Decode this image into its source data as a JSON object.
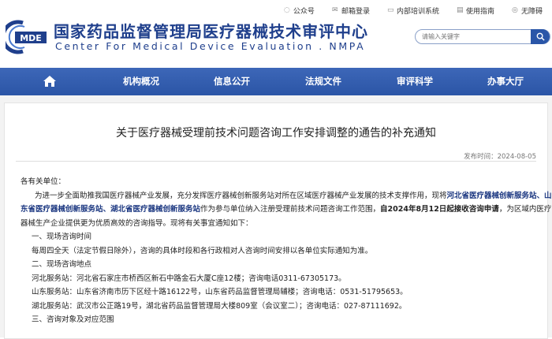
{
  "toplinks": [
    {
      "label": "公众号",
      "icon": "wechat-icon"
    },
    {
      "label": "邮箱登录",
      "icon": "mail-icon"
    },
    {
      "label": "内部培训系统",
      "icon": "training-icon"
    },
    {
      "label": "使用指南",
      "icon": "guide-icon"
    },
    {
      "label": "无障碍",
      "icon": "accessibility-icon"
    }
  ],
  "site": {
    "logo_text": "MDE",
    "title_cn": "国家药品监督管理局医疗器械技术审评中心",
    "title_en": "Center For Medical Device Evaluation . NMPA"
  },
  "search": {
    "placeholder": "请输入关键字"
  },
  "nav": {
    "items": [
      "机构概况",
      "信息公开",
      "法规文件",
      "审评科学",
      "办事大厅"
    ]
  },
  "article": {
    "title": "关于医疗器械受理前技术问题咨询工作安排调整的通告的补充通知",
    "date": "发布时间：2024-08-05",
    "salutation": "各有关单位：",
    "p1_a": "为进一步全面助推我国医疗器械产业发展，充分发挥医疗器械创新服务站对所在区域医疗器械产业发展的技术支撑作用，现将",
    "p1_b": "河北省医疗器械创新服务站、山",
    "p1_c": "东省医疗器械创新服务站、湖北省医疗器械创新服务站",
    "p1_d": "作为参与单位纳入注册受理前技术问题咨询工作范围，",
    "p1_e": "自2024年8月12日起接收咨询申请",
    "p1_f": "，为区域内医疗",
    "p1_g": "器械生产企业提供更为优质高效的咨询指导。现将有关事宜通知如下：",
    "s1": "一、现场咨询时间",
    "s1_text": "每周四全天（法定节假日除外），咨询的具体时段和各行政相对人咨询时间安排以各单位实际通知为准。",
    "s2": "二、现场咨询地点",
    "loc1": "河北服务站：河北省石家庄市桥西区新石中路金石大厦C座12楼；咨询电话0311-67305173。",
    "loc2": "山东服务站：山东省济南市历下区经十路16122号，山东省药品监督管理局辅楼；咨询电话：0531-51795653。",
    "loc3": "湖北服务站：武汉市公正路19号，湖北省药品监督管理局大楼809室（会议室二）；咨询电话：027-87111692。",
    "s3": "三、咨询对象及对应范围"
  }
}
